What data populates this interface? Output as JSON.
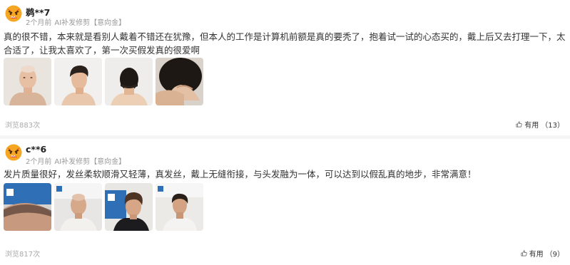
{
  "reviews": [
    {
      "username": "鹈**7",
      "time": "2个月前",
      "product": "AI补发修剪",
      "tag": "【意向金】",
      "content": "真的很不错，本来就是看别人戴着不错还在犹豫，但本人的工作是计算机前额是真的要秃了，抱着试一试的心态买的，戴上后又去打理一下，太合适了，让我太喜欢了，第一次买假发真的很爱啊",
      "views": "浏览883次",
      "helpful_label": "有用",
      "helpful_count": "（13）"
    },
    {
      "username": "c**6",
      "time": "2个月前",
      "product": "AI补发修剪",
      "tag": "【意向金】",
      "content": "发片质量很好，发丝柔软顺滑又轻薄，真发丝，戴上无缝衔接，与头发融为一体，可以达到以假乱真的地步，非常满意！",
      "views": "浏览817次",
      "helpful_label": "有用",
      "helpful_count": "（9）"
    }
  ],
  "icons": {
    "avatar": "angry-face-avatar-icon",
    "helpful": "thumbs-up-outline-icon"
  },
  "colors": {
    "avatar_orange": "#f5a623",
    "avatar_red": "#e8442a",
    "muted_text": "#999999"
  }
}
